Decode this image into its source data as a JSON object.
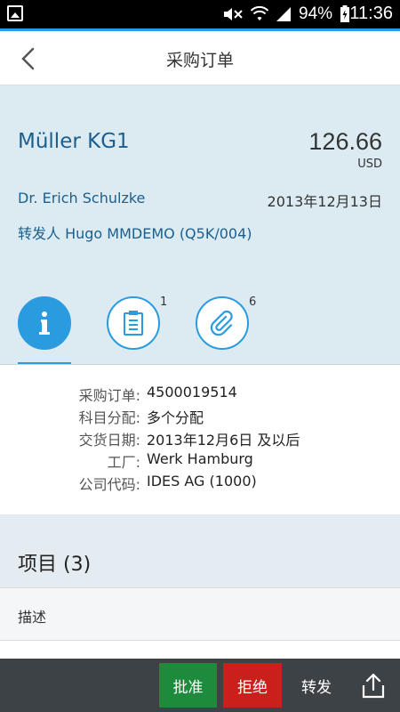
{
  "status_bar": {
    "battery": "94%",
    "time": "11:36"
  },
  "header": {
    "title": "采购订单"
  },
  "object_header": {
    "vendor": "Müller KG1",
    "amount": "126.66",
    "currency": "USD",
    "contact": "Dr. Erich Schulzke",
    "date": "2013年12月13日",
    "forwarder": "转发人 Hugo MMDEMO (Q5K/004)"
  },
  "tabs": [
    {
      "icon": "info-icon",
      "count": ""
    },
    {
      "icon": "notes-icon",
      "count": "1"
    },
    {
      "icon": "attachment-icon",
      "count": "6"
    }
  ],
  "fields": [
    {
      "label": "采购订单:",
      "value": "4500019514"
    },
    {
      "label": "科目分配:",
      "value": "多个分配"
    },
    {
      "label": "交货日期:",
      "value": "2013年12月6日 及以后"
    },
    {
      "label": "工厂:",
      "value": "Werk Hamburg"
    },
    {
      "label": "公司代码:",
      "value": "IDES AG (1000)"
    }
  ],
  "items": {
    "title": "项目 (3)",
    "column_description": "描述"
  },
  "footer": {
    "approve": "批准",
    "reject": "拒绝",
    "forward": "转发"
  },
  "colors": {
    "accent": "#2b9be0",
    "header_bg": "#dcebf2",
    "link_text": "#1a5f8f",
    "approve": "#1e8a3c",
    "reject": "#c9201c",
    "footer_bg": "#3c4246"
  }
}
